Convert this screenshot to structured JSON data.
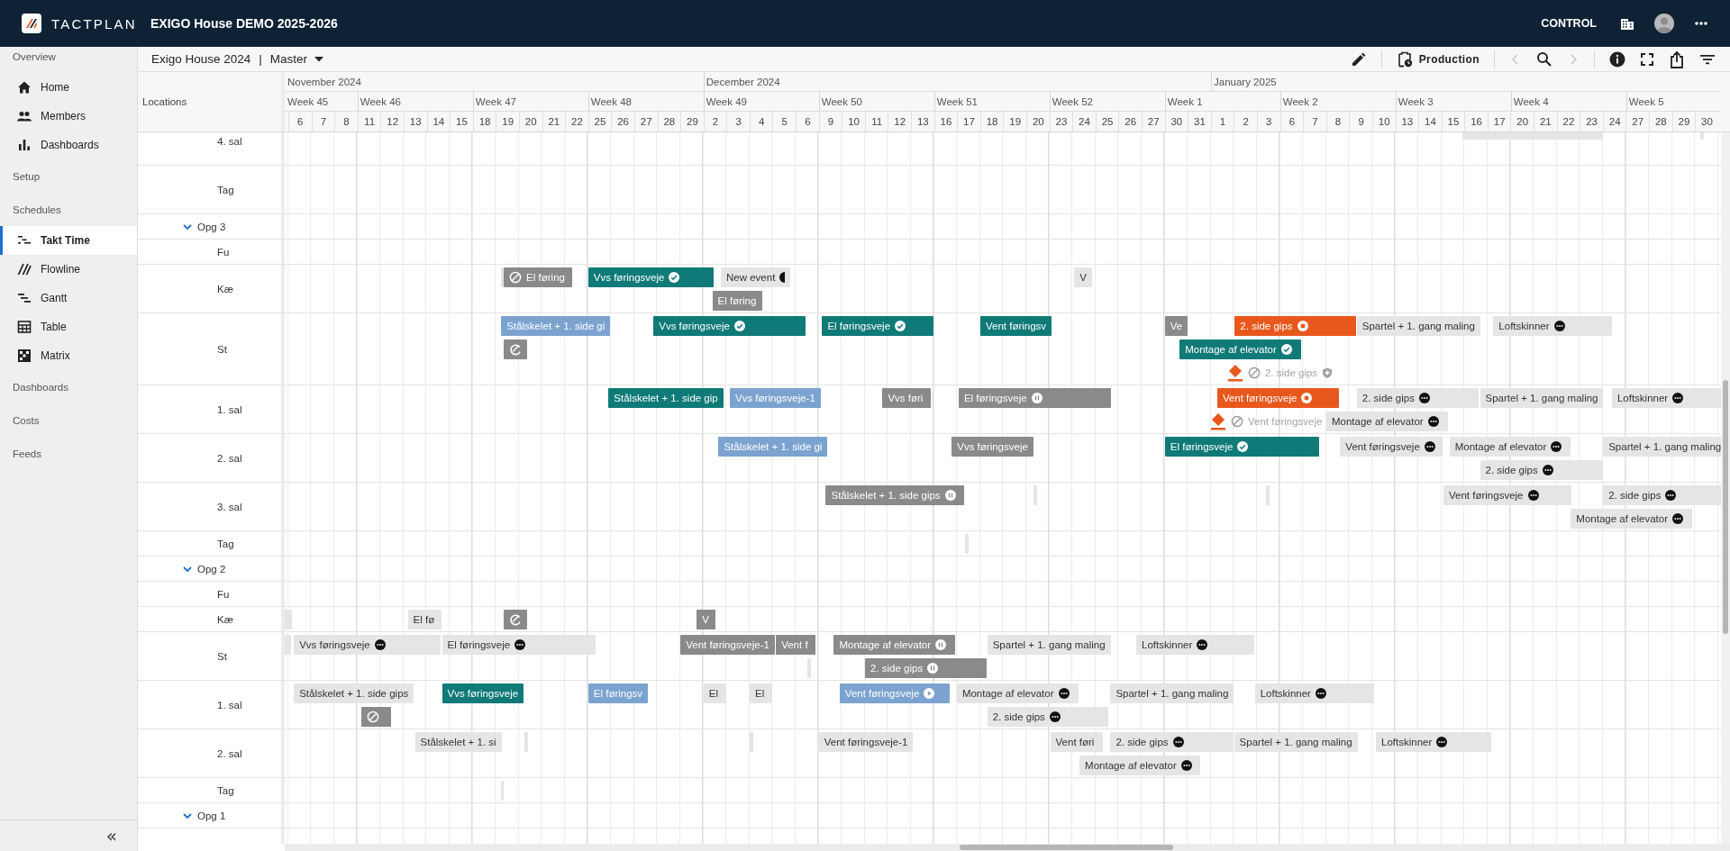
{
  "app_bar": {
    "brand": "TACTPLAN",
    "project": "EXIGO House DEMO 2025-2026",
    "mode": "CONTROL"
  },
  "sidebar": {
    "items": [
      {
        "kind": "section",
        "label": "Overview"
      },
      {
        "kind": "link",
        "label": "Home",
        "selected": false
      },
      {
        "kind": "link",
        "label": "Members",
        "selected": false
      },
      {
        "kind": "link",
        "label": "Dashboards",
        "selected": false
      },
      {
        "kind": "section",
        "label": "Setup"
      },
      {
        "kind": "section",
        "label": "Schedules"
      },
      {
        "kind": "link",
        "label": "Takt Time",
        "selected": true
      },
      {
        "kind": "link",
        "label": "Flowline",
        "selected": false
      },
      {
        "kind": "link",
        "label": "Gantt",
        "selected": false
      },
      {
        "kind": "link",
        "label": "Table",
        "selected": false
      },
      {
        "kind": "link",
        "label": "Matrix",
        "selected": false
      },
      {
        "kind": "section",
        "label": "Dashboards"
      },
      {
        "kind": "section",
        "label": "Costs"
      },
      {
        "kind": "section",
        "label": "Feeds"
      }
    ],
    "collapse": "«"
  },
  "toolbar": {
    "project": "Exigo House 2024",
    "separator": "|",
    "plan": "Master",
    "view": "Production",
    "previous": {
      "disabled": true
    },
    "next": {
      "disabled": true
    }
  },
  "timeline": {
    "locations_heading": "Locations",
    "months": [
      {
        "label": "November 2024"
      },
      {
        "label": "December 2024"
      },
      {
        "label": "January 2025"
      }
    ],
    "weeks": [
      {
        "label": "Week 45",
        "days": [
          "6",
          "7",
          "8"
        ]
      },
      {
        "label": "Week 46",
        "days": [
          "11",
          "12",
          "13",
          "14",
          "15"
        ]
      },
      {
        "label": "Week 47",
        "days": [
          "18",
          "19",
          "20",
          "21",
          "22"
        ]
      },
      {
        "label": "Week 48",
        "days": [
          "25",
          "26",
          "27",
          "28",
          "29"
        ]
      },
      {
        "label": "Week 49",
        "days": [
          "2",
          "3",
          "4",
          "5",
          "6"
        ]
      },
      {
        "label": "Week 50",
        "days": [
          "9",
          "10",
          "11",
          "12",
          "13"
        ]
      },
      {
        "label": "Week 51",
        "days": [
          "16",
          "17",
          "18",
          "19",
          "20"
        ]
      },
      {
        "label": "Week 52",
        "days": [
          "23",
          "24",
          "25",
          "26",
          "27"
        ]
      },
      {
        "label": "Week 1",
        "days": [
          "30",
          "31",
          "1",
          "2",
          "3"
        ]
      },
      {
        "label": "Week 2",
        "days": [
          "6",
          "7",
          "8",
          "9",
          "10"
        ]
      },
      {
        "label": "Week 3",
        "days": [
          "13",
          "14",
          "15",
          "16",
          "17"
        ]
      },
      {
        "label": "Week 4",
        "days": [
          "20",
          "21",
          "22",
          "23",
          "24"
        ]
      },
      {
        "label": "Week 5",
        "days": [
          "27",
          "28",
          "29",
          "30"
        ]
      }
    ]
  },
  "rows": [
    {
      "children": [
        {
          "label": "4. sal",
          "lanes": [
            [
              {
                "kind": "planned"
              },
              {
                "kind": "planned"
              }
            ]
          ]
        },
        {
          "label": "Tag"
        }
      ]
    },
    {
      "label": "Opg 3",
      "expanded": true,
      "children": [
        {
          "label": "Fu"
        },
        {
          "label": "Kæ",
          "lanes": [
            [
              {
                "kind": "planned"
              },
              {
                "label": "El føring",
                "kind": "paused",
                "lead_badge": {
                  "kind": "blocked"
                }
              },
              {
                "label": "Vvs føringsveje",
                "kind": "done",
                "status_badge": {
                  "kind": "check"
                }
              },
              {
                "label": "New event",
                "kind": "planned",
                "status_badge": {
                  "kind": "half"
                }
              },
              {
                "label": "V",
                "kind": "planned"
              }
            ],
            [
              {
                "label": "El føring",
                "kind": "paused"
              }
            ]
          ]
        },
        {
          "label": "St",
          "lanes": [
            [
              {
                "label": "Stålskelet + 1. side gi",
                "kind": "active"
              },
              {
                "label": "Vvs føringsveje",
                "kind": "done",
                "status_badge": {
                  "kind": "check"
                }
              },
              {
                "label": "El føringsveje",
                "kind": "done",
                "status_badge": {
                  "kind": "check"
                }
              },
              {
                "label": "Vent føringsv",
                "kind": "done"
              },
              {
                "label": "Ve",
                "kind": "paused"
              },
              {
                "label": "2. side gips",
                "kind": "delayed",
                "status_badge": {
                  "kind": "stop"
                }
              },
              {
                "label": "Spartel + 1. gang maling",
                "kind": "planned"
              },
              {
                "label": "Loftskinner",
                "kind": "planned",
                "status_badge": {
                  "kind": "more"
                }
              }
            ],
            [
              {
                "kind": "paused",
                "lead_badge": {
                  "kind": "loop"
                }
              },
              {
                "label": "Montage af elevator",
                "kind": "done",
                "status_badge": {
                  "kind": "check"
                }
              }
            ],
            [
              {
                "label": "2. side gips",
                "kind": "ghost",
                "lead_badge": {
                  "kind": "blocked"
                },
                "status_badge": {
                  "kind": "shield"
                }
              }
            ]
          ]
        },
        {
          "label": "1. sal",
          "lanes": [
            [
              {
                "label": "Stålskelet + 1. side gip",
                "kind": "done"
              },
              {
                "label": "Vvs føringsveje-1",
                "kind": "active"
              },
              {
                "label": "Vvs føri",
                "kind": "paused"
              },
              {
                "label": "El føringsveje",
                "kind": "paused",
                "status_badge": {
                  "kind": "pause"
                }
              },
              {
                "label": "Vent føringsveje",
                "kind": "delayed",
                "status_badge": {
                  "kind": "stop"
                }
              },
              {
                "label": "2. side gips",
                "kind": "planned",
                "status_badge": {
                  "kind": "more"
                }
              },
              {
                "label": "Spartel + 1. gang maling",
                "kind": "planned"
              },
              {
                "label": "Loftskinner",
                "kind": "planned",
                "status_badge": {
                  "kind": "more"
                }
              }
            ],
            [
              {
                "label": "Vent føringsveje",
                "kind": "ghost",
                "lead_badge": {
                  "kind": "blocked"
                }
              },
              {
                "label": "Montage af elevator",
                "kind": "planned",
                "status_badge": {
                  "kind": "more"
                }
              }
            ]
          ]
        },
        {
          "label": "2. sal",
          "lanes": [
            [
              {
                "label": "Stålskelet + 1. side gi",
                "kind": "active"
              },
              {
                "label": "Vvs føringsveje",
                "kind": "paused"
              },
              {
                "label": "El føringsveje",
                "kind": "done",
                "status_badge": {
                  "kind": "check"
                }
              },
              {
                "label": "Vent føringsveje",
                "kind": "planned",
                "status_badge": {
                  "kind": "more"
                }
              },
              {
                "label": "Montage af elevator",
                "kind": "planned",
                "status_badge": {
                  "kind": "more"
                }
              },
              {
                "label": "Spartel + 1. gang maling",
                "kind": "planned"
              }
            ],
            [
              {
                "label": "2. side gips",
                "kind": "planned",
                "status_badge": {
                  "kind": "more"
                }
              }
            ]
          ]
        },
        {
          "label": "3. sal",
          "lanes": [
            [
              {
                "label": "Stålskelet + 1. side gips",
                "kind": "paused",
                "status_badge": {
                  "kind": "pause"
                }
              },
              {
                "kind": "planned"
              },
              {
                "kind": "planned"
              },
              {
                "label": "Vent føringsveje",
                "kind": "planned",
                "status_badge": {
                  "kind": "more"
                }
              },
              {
                "label": "2. side gips",
                "kind": "planned",
                "status_badge": {
                  "kind": "more"
                }
              }
            ],
            [
              {
                "label": "Montage af elevator",
                "kind": "planned",
                "status_badge": {
                  "kind": "more"
                }
              }
            ]
          ]
        },
        {
          "label": "Tag",
          "lanes": [
            [
              {
                "kind": "planned"
              }
            ]
          ]
        }
      ]
    },
    {
      "label": "Opg 2",
      "expanded": true,
      "children": [
        {
          "label": "Fu"
        },
        {
          "label": "Kæ",
          "lanes": [
            [
              {
                "kind": "planned"
              },
              {
                "label": "El fø",
                "kind": "planned"
              },
              {
                "kind": "paused",
                "lead_badge": {
                  "kind": "loop"
                }
              },
              {
                "label": "V",
                "kind": "paused"
              }
            ]
          ]
        },
        {
          "label": "St",
          "lanes": [
            [
              {
                "kind": "planned"
              },
              {
                "label": "Vvs føringsveje",
                "kind": "planned",
                "status_badge": {
                  "kind": "more"
                }
              },
              {
                "label": "El føringsveje",
                "kind": "planned",
                "status_badge": {
                  "kind": "more"
                }
              },
              {
                "label": "Vent føringsveje-1",
                "kind": "paused"
              },
              {
                "label": "Vent f",
                "kind": "paused"
              },
              {
                "label": "Montage af elevator",
                "kind": "paused",
                "status_badge": {
                  "kind": "pause"
                }
              },
              {
                "label": "Spartel + 1. gang maling",
                "kind": "planned"
              },
              {
                "label": "Loftskinner",
                "kind": "planned",
                "status_badge": {
                  "kind": "more"
                }
              }
            ],
            [
              {
                "kind": "planned"
              },
              {
                "label": "2. side gips",
                "kind": "paused",
                "status_badge": {
                  "kind": "pause"
                }
              }
            ]
          ]
        },
        {
          "label": "1. sal",
          "lanes": [
            [
              {
                "label": "Stålskelet + 1. side gips",
                "kind": "planned"
              },
              {
                "label": "Vvs føringsveje",
                "kind": "done"
              },
              {
                "label": "El føringsv",
                "kind": "active"
              },
              {
                "label": "El",
                "kind": "planned"
              },
              {
                "label": "El",
                "kind": "planned"
              },
              {
                "label": "Vent føringsveje",
                "kind": "active",
                "status_badge": {
                  "kind": "play"
                }
              },
              {
                "label": "Montage af elevator",
                "kind": "planned",
                "status_badge": {
                  "kind": "more"
                }
              },
              {
                "label": "Spartel + 1. gang maling",
                "kind": "planned"
              },
              {
                "label": "Loftskinner",
                "kind": "planned",
                "status_badge": {
                  "kind": "more"
                }
              }
            ],
            [
              {
                "kind": "paused",
                "lead_badge": {
                  "kind": "blocked"
                }
              },
              {
                "label": "2. side gips",
                "kind": "planned",
                "status_badge": {
                  "kind": "more"
                }
              }
            ]
          ]
        },
        {
          "label": "2. sal",
          "lanes": [
            [
              {
                "label": "Stålskelet + 1. si",
                "kind": "planned"
              },
              {
                "kind": "planned"
              },
              {
                "kind": "planned"
              },
              {
                "label": "Vent føringsveje-1",
                "kind": "planned"
              },
              {
                "label": "Vent føri",
                "kind": "planned"
              },
              {
                "label": "2. side gips",
                "kind": "planned",
                "status_badge": {
                  "kind": "more"
                }
              },
              {
                "label": "Spartel + 1. gang maling",
                "kind": "planned"
              },
              {
                "label": "Loftskinner",
                "kind": "planned",
                "status_badge": {
                  "kind": "more"
                }
              }
            ],
            [
              {
                "label": "Montage af elevator",
                "kind": "planned",
                "status_badge": {
                  "kind": "more"
                }
              }
            ]
          ]
        },
        {
          "label": "Tag",
          "lanes": [
            [
              {
                "kind": "planned"
              }
            ]
          ]
        }
      ]
    },
    {
      "label": "Opg 1",
      "expanded": true
    }
  ]
}
